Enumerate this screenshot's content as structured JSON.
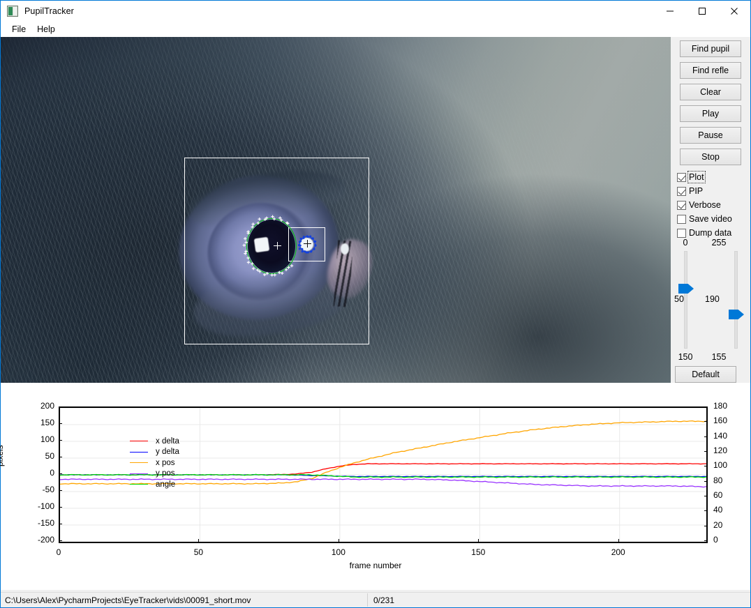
{
  "window": {
    "title": "PupilTracker",
    "icon": "app-icon",
    "minimize_label": "–",
    "maximize_label": "□",
    "close_label": "✕"
  },
  "menu": {
    "items": [
      {
        "label": "File"
      },
      {
        "label": "Help"
      }
    ]
  },
  "video": {
    "overlay": {
      "pupil_roi": "pupil-region-of-interest",
      "reflection_roi": "reflection-region-of-interest",
      "pupil_ellipse_color": "#00c000",
      "reflection_ellipse_color": "#1240e0",
      "contour_point_color": "#ffffff",
      "reflection_point_color": "#1240e0"
    }
  },
  "controls": {
    "buttons": [
      {
        "label": "Find pupil",
        "name": "find-pupil-button"
      },
      {
        "label": "Find refle",
        "name": "find-reflection-button"
      },
      {
        "label": "Clear",
        "name": "clear-button"
      },
      {
        "label": "Play",
        "name": "play-button"
      },
      {
        "label": "Pause",
        "name": "pause-button"
      },
      {
        "label": "Stop",
        "name": "stop-button"
      }
    ],
    "checkboxes": [
      {
        "label": "Plot",
        "checked": true,
        "focused": true
      },
      {
        "label": "PIP",
        "checked": true,
        "focused": false
      },
      {
        "label": "Verbose",
        "checked": true,
        "focused": false
      },
      {
        "label": "Save video",
        "checked": false,
        "focused": false
      },
      {
        "label": "Dump data",
        "checked": false,
        "focused": false
      }
    ],
    "sliders": [
      {
        "name": "pupil-threshold-slider",
        "top_label": "0",
        "bottom_label": "150",
        "value": "50",
        "value_position_pct": 42
      },
      {
        "name": "reflection-threshold-slider",
        "top_label": "255",
        "bottom_label": "155",
        "value": "190",
        "value_position_pct": 66
      }
    ],
    "default_button": "Default",
    "accent_color": "#0078d7"
  },
  "chart_data": {
    "type": "line",
    "title": "",
    "xlabel": "frame number",
    "ylabel": "pixels",
    "xlim": [
      0,
      231
    ],
    "ylim": [
      -200,
      200
    ],
    "y2lim": [
      0,
      180
    ],
    "grid": true,
    "legend_position": "upper left",
    "xticks": [
      0,
      50,
      100,
      150,
      200
    ],
    "yticks": [
      -200,
      -150,
      -100,
      -50,
      0,
      50,
      100,
      150,
      200
    ],
    "y2ticks": [
      0,
      20,
      40,
      60,
      80,
      100,
      120,
      140,
      160,
      180
    ],
    "x": [
      0,
      10,
      20,
      30,
      40,
      50,
      60,
      70,
      80,
      85,
      90,
      95,
      100,
      105,
      110,
      120,
      130,
      140,
      150,
      160,
      170,
      180,
      190,
      200,
      210,
      220,
      231
    ],
    "series": [
      {
        "name": "x delta",
        "color": "#ff0000",
        "axis": "left",
        "values": [
          0,
          0,
          0,
          0,
          0,
          0,
          0,
          0,
          1,
          3,
          8,
          18,
          26,
          31,
          33,
          33,
          33,
          33,
          33,
          33,
          33,
          33,
          33,
          33,
          33,
          33,
          33
        ]
      },
      {
        "name": "y delta",
        "color": "#0000ff",
        "axis": "left",
        "values": [
          0,
          0,
          0,
          0,
          0,
          0,
          0,
          0,
          0,
          -1,
          -2,
          -3,
          -4,
          -5,
          -5,
          -5,
          -5,
          -5,
          -5,
          -5,
          -5,
          -5,
          -5,
          -5,
          -5,
          -5,
          -5
        ]
      },
      {
        "name": "x pos",
        "color": "#ffa500",
        "axis": "right",
        "values": [
          78,
          78,
          78,
          78,
          78,
          78,
          78,
          78,
          79,
          81,
          85,
          93,
          100,
          106,
          111,
          120,
          127,
          134,
          140,
          146,
          151,
          155,
          158,
          160,
          161,
          162,
          162
        ]
      },
      {
        "name": "y pos",
        "color": "#9933ff",
        "axis": "right",
        "values": [
          84,
          84,
          84,
          84,
          84,
          84,
          84,
          84,
          84,
          84,
          84,
          84,
          84,
          84,
          84,
          84,
          84,
          83,
          81,
          79,
          77,
          76,
          75,
          75,
          75,
          75,
          74
        ]
      },
      {
        "name": "angle",
        "color": "#00dd00",
        "axis": "right",
        "values": [
          90,
          90,
          90,
          90,
          90,
          90,
          90,
          90,
          90,
          90,
          90,
          89,
          88,
          87,
          87,
          87,
          87,
          87,
          87,
          87,
          87,
          87,
          87,
          87,
          87,
          87,
          87
        ]
      }
    ]
  },
  "statusbar": {
    "path": "C:\\Users\\Alex\\PycharmProjects\\EyeTracker\\vids\\00091_short.mov",
    "frames": "0/231"
  }
}
